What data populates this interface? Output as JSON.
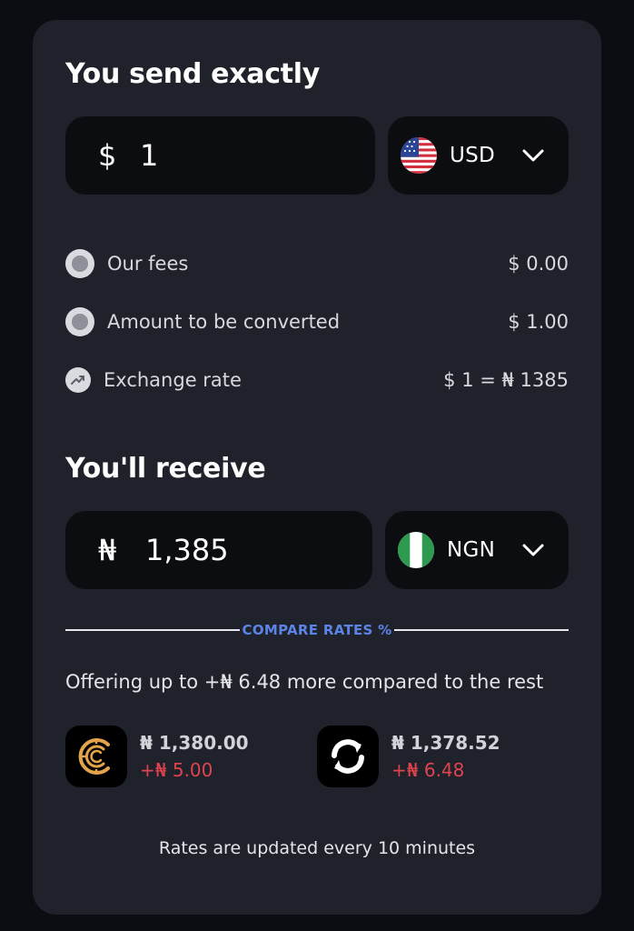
{
  "send": {
    "title": "You send exactly",
    "symbol": "$",
    "amount": "1",
    "currency_code": "USD",
    "currency_flag_icon": "us-flag-icon"
  },
  "details": [
    {
      "label": "Our fees",
      "value": "$ 0.00",
      "icon": "circle-dot-icon"
    },
    {
      "label": "Amount to be converted",
      "value": "$ 1.00",
      "icon": "circle-dot-icon"
    },
    {
      "label": "Exchange rate",
      "value": "$ 1 = ₦ 1385",
      "icon": "trending-up-icon"
    }
  ],
  "receive": {
    "title": "You'll receive",
    "symbol": "₦",
    "amount": "1,385",
    "currency_code": "NGN",
    "currency_flag_icon": "ng-flag-icon"
  },
  "compare": {
    "label": "COMPARE RATES %",
    "offer_text": "Offering up to +₦ 6.48 more compared to the rest",
    "providers": [
      {
        "rate": "₦ 1,380.00",
        "diff": "+₦ 5.00",
        "logo_icon": "c-ring-logo-icon"
      },
      {
        "rate": "₦ 1,378.52",
        "diff": "+₦ 6.48",
        "logo_icon": "sync-arrows-logo-icon"
      }
    ],
    "footnote": "Rates are updated every 10 minutes"
  },
  "colors": {
    "card_bg": "#1f222a",
    "input_bg": "#0c0d11",
    "accent_blue": "#5b84e6",
    "negative_red": "#e0434f"
  }
}
